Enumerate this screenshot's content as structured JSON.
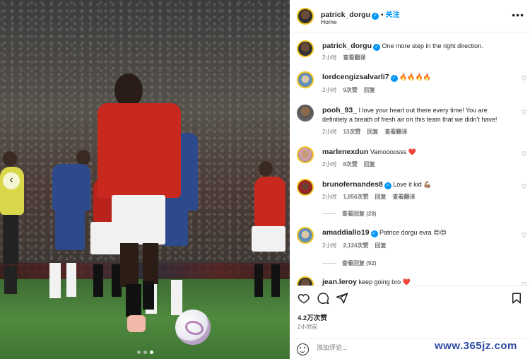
{
  "header": {
    "username": "patrick_dorgu",
    "follow_label": "关注",
    "separator": "•",
    "subtitle": "Home",
    "more_label": "•••"
  },
  "photo": {
    "prev_label": "‹",
    "carousel": {
      "count": 3,
      "active": 3
    }
  },
  "comments": [
    {
      "user": "patrick_dorgu",
      "verified": true,
      "text": "One more step in the right direction.",
      "time": "2小时",
      "likes": "",
      "reply": "",
      "translate": "查看翻译"
    },
    {
      "user": "lordcengizsalvarli7",
      "verified": true,
      "text": "🔥🔥🔥🔥",
      "time": "2小时",
      "likes": "9次赞",
      "reply": "回复",
      "translate": ""
    },
    {
      "user": "pooh_93_",
      "verified": false,
      "text": "I love your heart out there every time! You are definitely a breath of fresh air on this team that we didn't have!",
      "time": "2小时",
      "likes": "13次赞",
      "reply": "回复",
      "translate": "查看翻译"
    },
    {
      "user": "marlenexdun",
      "verified": false,
      "text": "Vamoooosss ❤️",
      "time": "2小时",
      "likes": "8次赞",
      "reply": "回复",
      "translate": ""
    },
    {
      "user": "brunofernandes8",
      "verified": true,
      "text": "Love it kid 💪🏽",
      "time": "2小时",
      "likes": "1,856次赞",
      "reply": "回复",
      "translate": "查看翻译",
      "view_replies": "查看回复 (28)"
    },
    {
      "user": "amaddiallo19",
      "verified": true,
      "text": "Patrice dorgu evra 😍😍",
      "time": "2小时",
      "likes": "2,124次赞",
      "reply": "回复",
      "translate": "",
      "view_replies": "查看回复 (92)"
    },
    {
      "user": "jean.leroy",
      "verified": false,
      "text": "keep going bro ❤️",
      "time": "",
      "likes": "",
      "reply": "",
      "translate": ""
    }
  ],
  "actions": {
    "likes": "4.2万次赞",
    "time": "2小时前",
    "comment_placeholder": "添加评论..."
  },
  "watermark": "www.365jz.com",
  "colors": {
    "link": "#0095f6",
    "muted": "#737373",
    "text": "#262626"
  }
}
